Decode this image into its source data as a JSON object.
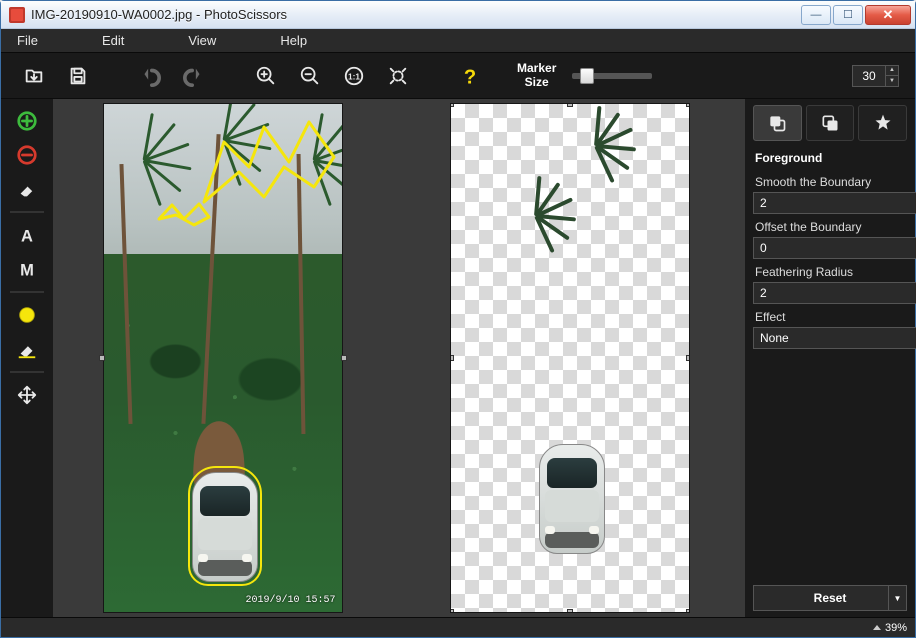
{
  "titlebar": {
    "title": "IMG-20190910-WA0002.jpg - PhotoScissors"
  },
  "menu": {
    "file": "File",
    "edit": "Edit",
    "view": "View",
    "help": "Help"
  },
  "toolbar": {
    "marker_label_top": "Marker",
    "marker_label_bottom": "Size",
    "marker_value": "30"
  },
  "panel": {
    "section": "Foreground",
    "smooth_label": "Smooth the Boundary",
    "smooth_value": "2",
    "offset_label": "Offset the Boundary",
    "offset_value": "0",
    "feather_label": "Feathering Radius",
    "feather_value": "2",
    "effect_label": "Effect",
    "effect_value": "None",
    "reset": "Reset"
  },
  "image": {
    "timestamp": "2019/9/10  15:57"
  },
  "status": {
    "zoom": "39%"
  }
}
